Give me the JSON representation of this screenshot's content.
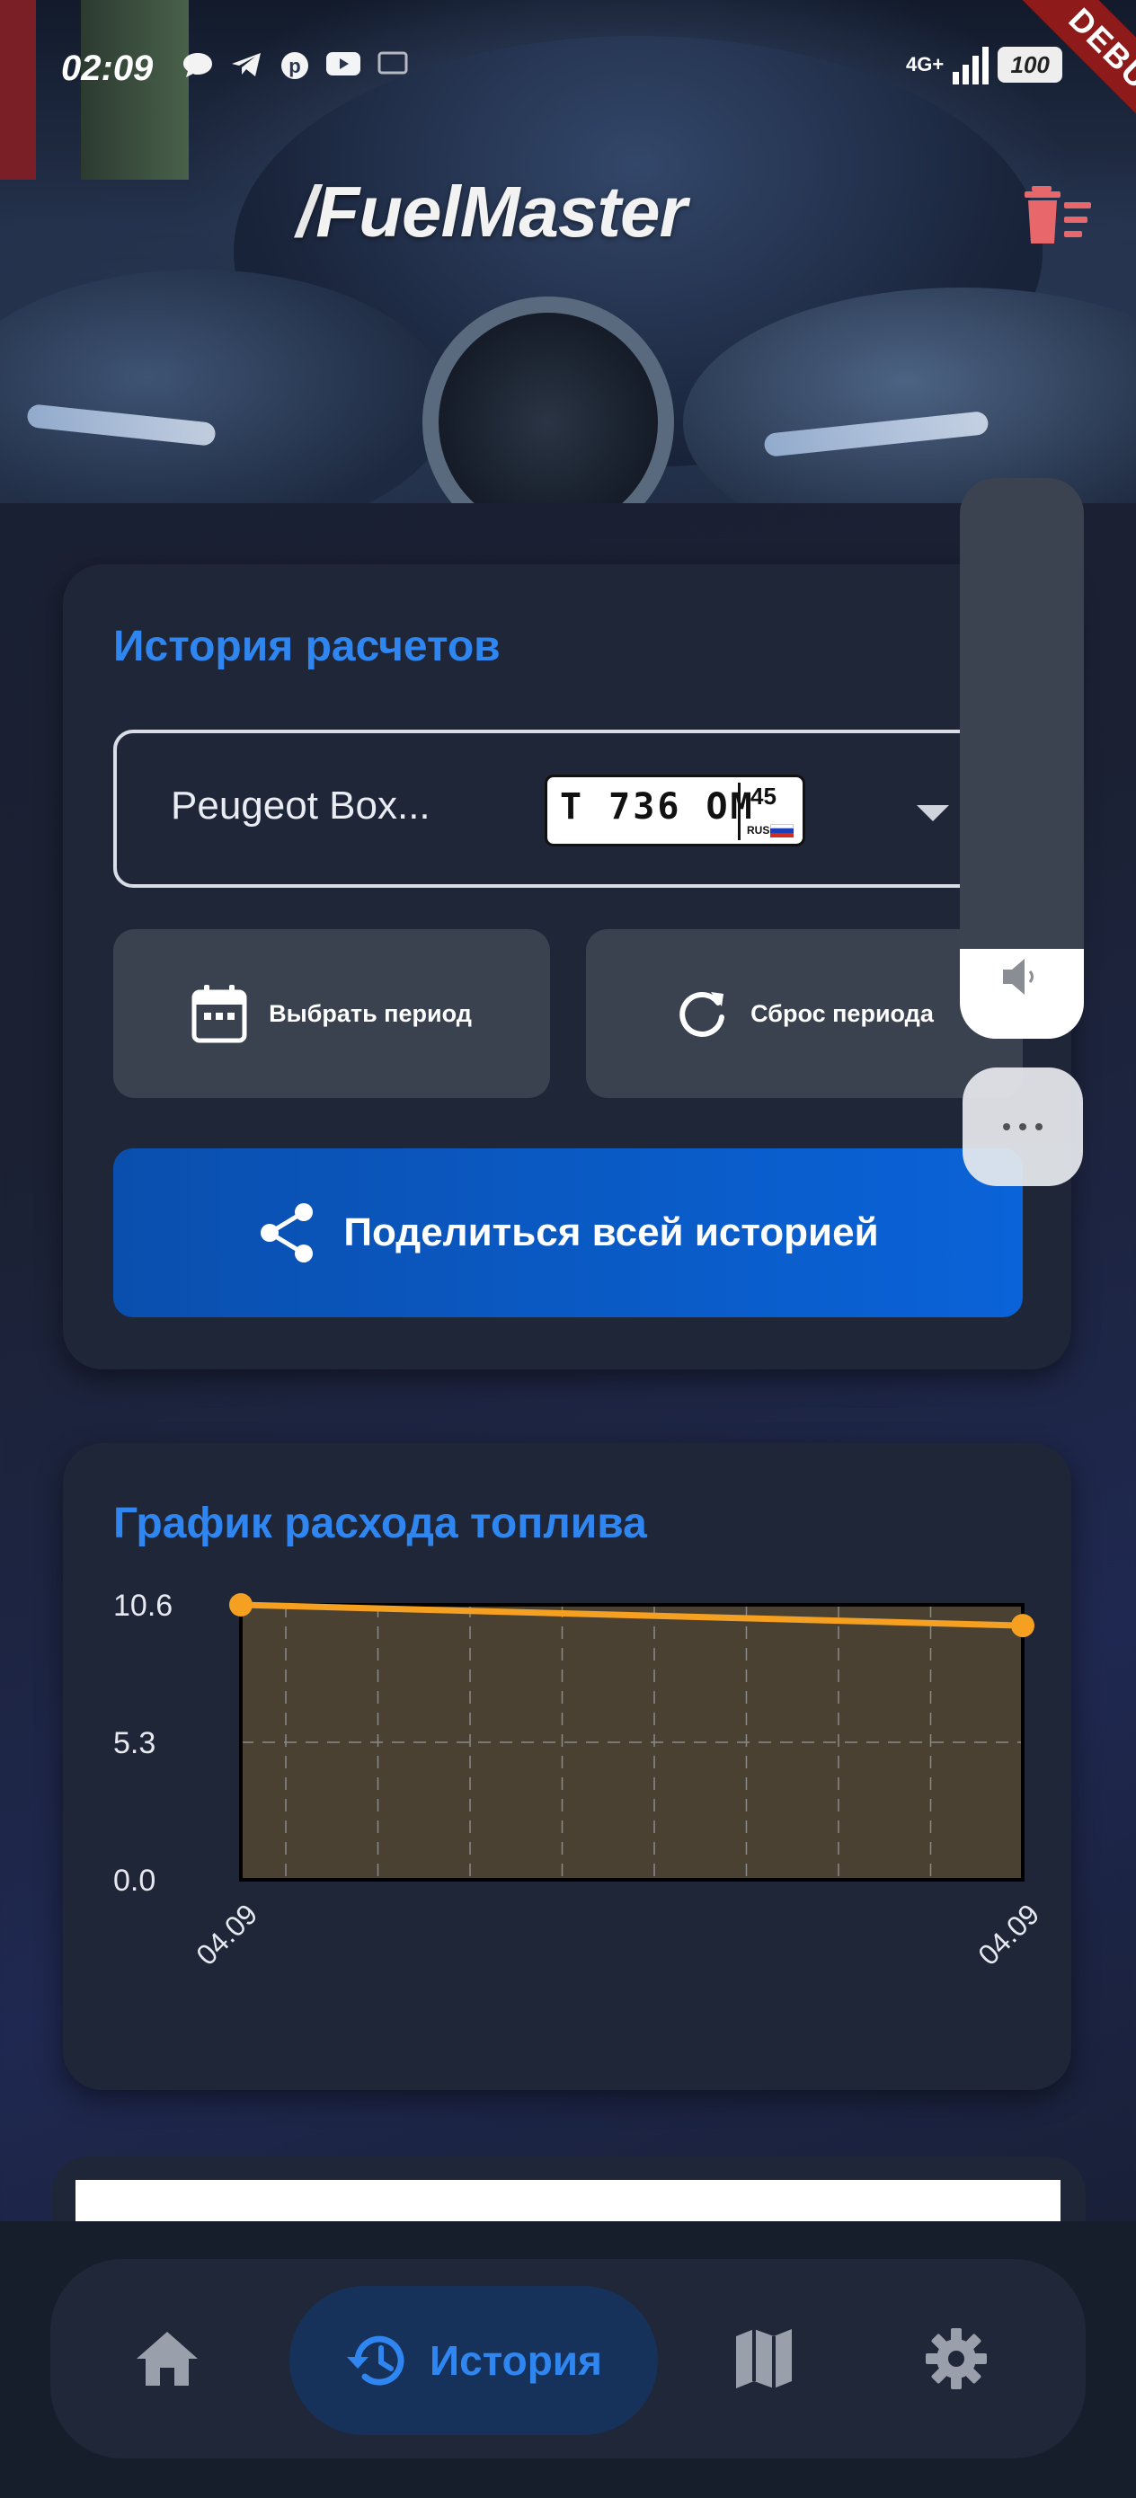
{
  "status_bar": {
    "time": "02:09",
    "network": "4G+",
    "battery": "100",
    "notification_icons": [
      "chat-icon",
      "telegram-icon",
      "pinterest-icon",
      "youtube-icon",
      "cast-icon"
    ]
  },
  "debug_banner": "DEBUG",
  "header": {
    "logo_text": "FuelMaster",
    "clear_history_icon": "trash-list-icon"
  },
  "history_card": {
    "title": "История расчетов",
    "vehicle": {
      "name": "Peugeot Box...",
      "plate_number": "Т 736 ОМ",
      "plate_region": "45",
      "plate_country": "RUS"
    },
    "select_period_label": "Выбрать период",
    "reset_period_label": "Сброс периода",
    "share_all_label": "Поделиться всей историей"
  },
  "chart_card": {
    "title": "График расхода топлива"
  },
  "chart_data": {
    "type": "area",
    "x": [
      "04.09",
      "04.09"
    ],
    "series": [
      {
        "values": [
          10.6,
          9.8
        ]
      }
    ],
    "yticks": [
      "0.0",
      "5.3",
      "10.6"
    ],
    "xticks": [
      "04.09",
      "04.09"
    ],
    "ylim": [
      0,
      10.6
    ],
    "grid": true,
    "colors": {
      "line": "#f5a020",
      "fill": "#4a4132",
      "grid": "#8a8a8a"
    }
  },
  "bottom_nav": {
    "items": [
      {
        "name": "home",
        "icon": "home-icon"
      },
      {
        "name": "history",
        "icon": "history-icon",
        "label": "История",
        "active": true
      },
      {
        "name": "map",
        "icon": "map-icon"
      },
      {
        "name": "settings",
        "icon": "gear-icon"
      }
    ]
  },
  "volume_overlay": {
    "level": 0.16,
    "icon": "speaker-icon"
  },
  "colors": {
    "accent": "#2f86f0",
    "card_bg": "#1e2638",
    "share_button": "#0a5cc8",
    "trash_icon": "#e8676b"
  }
}
